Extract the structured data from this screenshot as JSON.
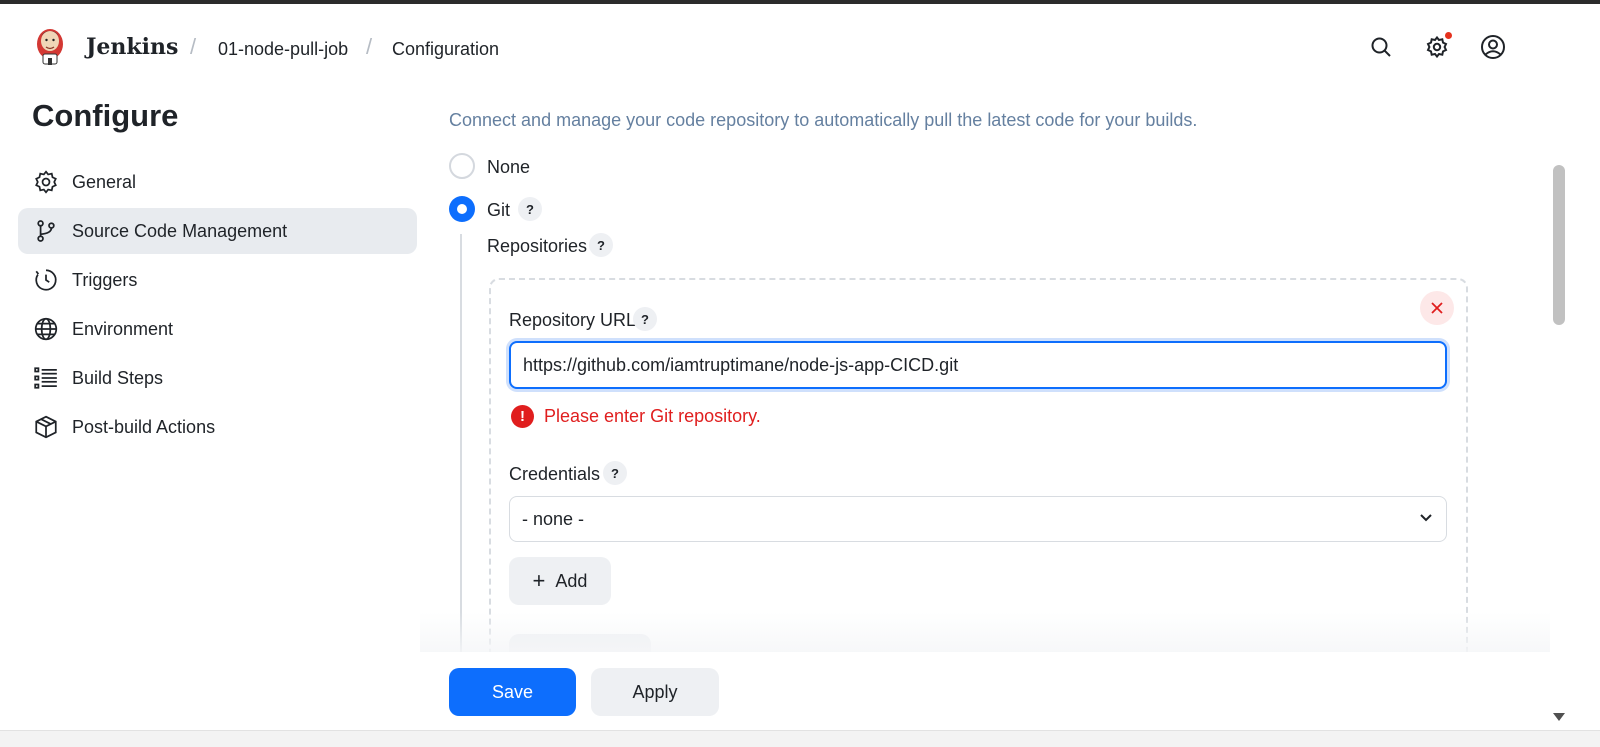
{
  "header": {
    "brand": "Jenkins",
    "breadcrumbs": [
      "01-node-pull-job",
      "Configuration"
    ],
    "separator": "/",
    "icons": [
      "search-icon",
      "settings-icon",
      "user-icon"
    ]
  },
  "sidebar": {
    "title": "Configure",
    "items": [
      {
        "label": "General",
        "icon": "gear-icon"
      },
      {
        "label": "Source Code Management",
        "icon": "git-branch-icon",
        "active": true
      },
      {
        "label": "Triggers",
        "icon": "clock-icon"
      },
      {
        "label": "Environment",
        "icon": "globe-icon"
      },
      {
        "label": "Build Steps",
        "icon": "list-icon"
      },
      {
        "label": "Post-build Actions",
        "icon": "package-icon"
      }
    ]
  },
  "scm": {
    "description": "Connect and manage your code repository to automatically pull the latest code for your builds.",
    "options": {
      "none": "None",
      "git": "Git"
    },
    "selected": "Git",
    "repositories_label": "Repositories",
    "help": "?",
    "repository_url_label": "Repository URL",
    "repository_url_value": "https://github.com/iamtruptimane/node-js-app-CICD.git",
    "error_icon": "!",
    "error_text": "Please enter Git repository.",
    "credentials_label": "Credentials",
    "credentials_value": "- none -",
    "add_label": "Add",
    "add_icon": "+"
  },
  "actions": {
    "save": "Save",
    "apply": "Apply"
  },
  "colors": {
    "primary": "#0d6efd",
    "error": "#e01e1e",
    "description": "#6580a0"
  }
}
